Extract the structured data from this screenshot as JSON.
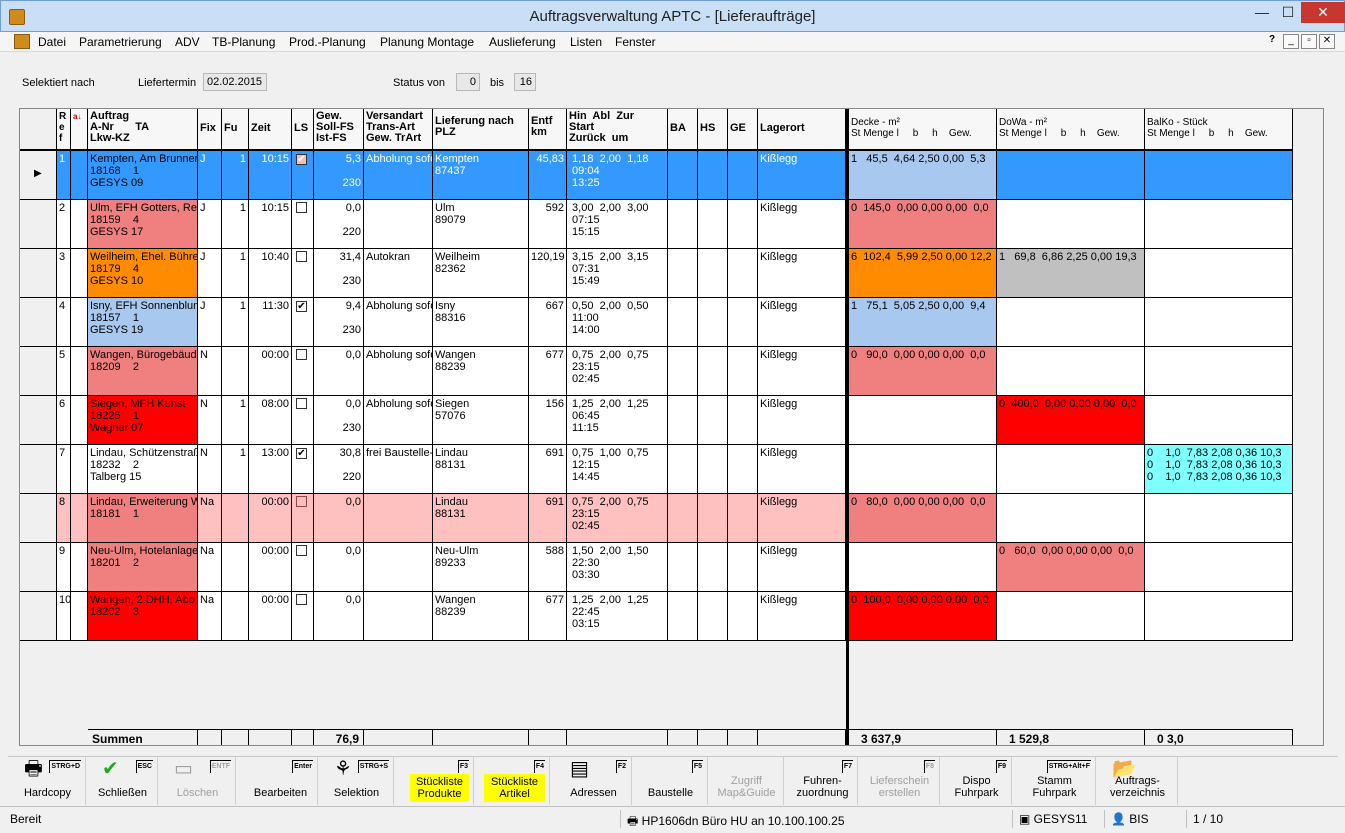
{
  "window": {
    "title": "Auftragsverwaltung APTC - [Lieferaufträge]",
    "min": "—",
    "max": "☐",
    "close": "✕"
  },
  "menu": [
    "Datei",
    "Parametrierung",
    "ADV",
    "TB-Planung",
    "Prod.-Planung",
    "Planung Montage",
    "Auslieferung",
    "Listen",
    "Fenster"
  ],
  "mdi": {
    "help": "?",
    "min": "_",
    "restore": "▫",
    "close": "✕"
  },
  "filter": {
    "selected_by_label": "Selektiert nach",
    "date_label": "Liefertermin",
    "date_value": "02.02.2015",
    "status_label": "Status von",
    "status_from": "0",
    "status_to_label": "bis",
    "status_to": "16"
  },
  "columns": {
    "ref": "R\ne\nf",
    "sort": "a↓",
    "auftrag": "Auftrag\nA-Nr       TA\nLkw-KZ",
    "fix": "Fix",
    "fu": "Fu",
    "zeit": "Zeit",
    "ls": "LS",
    "gew": "Gew.\nSoll-FS\nIst-FS",
    "versand": "Versandart\nTrans-Art\nGew. TrArt",
    "lieferung": "Lieferung nach\nPLZ",
    "entf": "Entf\nkm",
    "hin": "Hin  Abl  Zur\nStart\nZurück  um",
    "ba": "BA",
    "hs": "HS",
    "ge": "GE",
    "lagerort": "Lagerort",
    "decke": "Decke - m²\nSt Menge l     b     h    Gew.",
    "dowa": "DoWa - m²\nSt Menge l     b     h    Gew.",
    "balko": "BalKo - Stück\nSt Menge l     b     h    Gew."
  },
  "rows": [
    {
      "ref": "1",
      "auftrag": "Kempten, Am Brunner\n18168    1\nGESYS 09",
      "fix": "J",
      "fu": "1",
      "zeit": "10:15",
      "ls": "✔",
      "gew": "5,3\n\n230",
      "versand": "Abholung sofo",
      "lief": "Kempten\n87437",
      "entf": "45,83",
      "hin": " 1,18  2,00  1,18\n 09:04\n 13:25",
      "lager": "Kißlegg",
      "decke": "1   45,5  4,64 2,50 0,00  5,3",
      "dowa": "",
      "balko": ""
    },
    {
      "ref": "2",
      "auftrag": "Ulm, EFH Gotters, Rei\n18159    4\nGESYS 17",
      "fix": "J",
      "fu": "1",
      "zeit": "10:15",
      "ls": "",
      "gew": "0,0\n\n220",
      "versand": "",
      "lief": "Ulm\n89079",
      "entf": "592",
      "hin": " 3,00  2,00  3,00\n 07:15\n 15:15",
      "lager": "Kißlegg",
      "decke": "0  145,0  0,00 0,00 0,00  0,0",
      "dowa": "",
      "balko": ""
    },
    {
      "ref": "3",
      "auftrag": "Weilheim, Ehel. Bühre\n18179    4\nGESYS 10",
      "fix": "J",
      "fu": "1",
      "zeit": "10:40",
      "ls": "",
      "gew": "31,4\n\n230",
      "versand": "Autokran",
      "lief": "Weilheim\n82362",
      "entf": "120,19",
      "hin": " 3,15  2,00  3,15\n 07:31\n 15:49",
      "lager": "Kißlegg",
      "decke": "6  102,4  5,99 2,50 0,00 12,2",
      "dowa": "1   69,8  6,86 2,25 0,00 19,3",
      "balko": ""
    },
    {
      "ref": "4",
      "auftrag": "Isny, EFH Sonnenblun\n18157    1\nGESYS 19",
      "fix": "J",
      "fu": "1",
      "zeit": "11:30",
      "ls": "✔",
      "gew": "9,4\n\n230",
      "versand": "Abholung sofo",
      "lief": "Isny\n88316",
      "entf": "667",
      "hin": " 0,50  2,00  0,50\n 11:00\n 14:00",
      "lager": "Kißlegg",
      "decke": "1   75,1  5,05 2,50 0,00  9,4",
      "dowa": "",
      "balko": ""
    },
    {
      "ref": "5",
      "auftrag": "Wangen, Bürogebäud\n18209    2",
      "fix": "N",
      "fu": "",
      "zeit": "00:00",
      "ls": "",
      "gew": "0,0",
      "versand": "Abholung sofo",
      "lief": "Wangen\n88239",
      "entf": "677",
      "hin": " 0,75  2,00  0,75\n 23:15\n 02:45",
      "lager": "Kißlegg",
      "decke": "0   90,0  0,00 0,00 0,00  0,0",
      "dowa": "",
      "balko": ""
    },
    {
      "ref": "6",
      "auftrag": "Siegen, MFH Kunst\n18225    1\nWagner 07",
      "fix": "N",
      "fu": "1",
      "zeit": "08:00",
      "ls": "",
      "gew": "0,0\n\n230",
      "versand": "Abholung sofo",
      "lief": "Siegen\n57076",
      "entf": "156",
      "hin": " 1,25  2,00  1,25\n 06:45\n 11:15",
      "lager": "Kißlegg",
      "decke": "",
      "dowa": "0  400,0  0,00 0,00 0,00  0,0",
      "balko": ""
    },
    {
      "ref": "7",
      "auftrag": "Lindau, Schützenstraß\n18232    2\nTalberg 15",
      "fix": "N",
      "fu": "1",
      "zeit": "13:00",
      "ls": "✔",
      "gew": "30,8\n\n220",
      "versand": "frei Baustelle-S",
      "lief": "Lindau\n88131",
      "entf": "691",
      "hin": " 0,75  1,00  0,75\n 12:15\n 14:45",
      "lager": "Kißlegg",
      "decke": "",
      "dowa": "",
      "balko": "0    1,0  7,83 2,08 0,36 10,3\n0    1,0  7,83 2,08 0,36 10,3\n0    1,0  7,83 2,08 0,36 10,3"
    },
    {
      "ref": "8",
      "auftrag": "Lindau, Erweiterung W\n18181    1",
      "fix": "Na",
      "fu": "",
      "zeit": "00:00",
      "ls": "",
      "gew": "0,0",
      "versand": "",
      "lief": "Lindau\n88131",
      "entf": "691",
      "hin": " 0,75  2,00  0,75\n 23:15\n 02:45",
      "lager": "Kißlegg",
      "decke": "0   80,0  0,00 0,00 0,00  0,0",
      "dowa": "",
      "balko": ""
    },
    {
      "ref": "9",
      "auftrag": "Neu-Ulm, Hotelanlage\n18201    2",
      "fix": "Na",
      "fu": "",
      "zeit": "00:00",
      "ls": "",
      "gew": "0,0",
      "versand": "",
      "lief": "Neu-Ulm\n89233",
      "entf": "588",
      "hin": " 1,50  2,00  1,50\n 22:30\n 03:30",
      "lager": "Kißlegg",
      "decke": "",
      "dowa": "0   60,0  0,00 0,00 0,00  0,0",
      "balko": ""
    },
    {
      "ref": "10",
      "auftrag": "Wangen, 2.DHH, Abo\n18202    3",
      "fix": "Na",
      "fu": "",
      "zeit": "00:00",
      "ls": "",
      "gew": "0,0",
      "versand": "",
      "lief": "Wangen\n88239",
      "entf": "677",
      "hin": " 1,25  2,00  1,25\n 22:45\n 03:15",
      "lager": "Kißlegg",
      "decke": "0  100,0  0,00 0,00 0,00  0,0",
      "dowa": "",
      "balko": ""
    }
  ],
  "sums": {
    "label": "Summen",
    "gew": "76,9",
    "decke": "3 637,9",
    "dowa": "1 529,8",
    "balko": "0 3,0"
  },
  "toolbar": [
    {
      "label": "Hardcopy",
      "key": "STRG+D"
    },
    {
      "label": "Schließen",
      "key": "ESC"
    },
    {
      "label": "Löschen",
      "key": "ENTF"
    },
    {
      "label": "Bearbeiten",
      "key": "Enter"
    },
    {
      "label": "Selektion",
      "key": "STRG+S"
    },
    {
      "label": "Stückliste\nProdukte",
      "key": "F3"
    },
    {
      "label": "Stückliste\nArtikel",
      "key": "F4"
    },
    {
      "label": "Adressen",
      "key": "F2"
    },
    {
      "label": "Baustelle",
      "key": "F5"
    },
    {
      "label": "Zugriff\nMap&Guide",
      "key": ""
    },
    {
      "label": "Fuhren-\nzuordnung",
      "key": "F7"
    },
    {
      "label": "Lieferschein\nerstellen",
      "key": "F8"
    },
    {
      "label": "Dispo\nFuhrpark",
      "key": "F9"
    },
    {
      "label": "Stamm\nFuhrpark",
      "key": "STRG+Alt+F"
    },
    {
      "label": "Auftrags-\nverzeichnis",
      "key": ""
    }
  ],
  "status": {
    "left": "Bereit",
    "printer": "HP1606dn Büro HU an 10.100.100.25",
    "db": "GESYS11",
    "user": "BIS",
    "page": "1 / 10"
  }
}
